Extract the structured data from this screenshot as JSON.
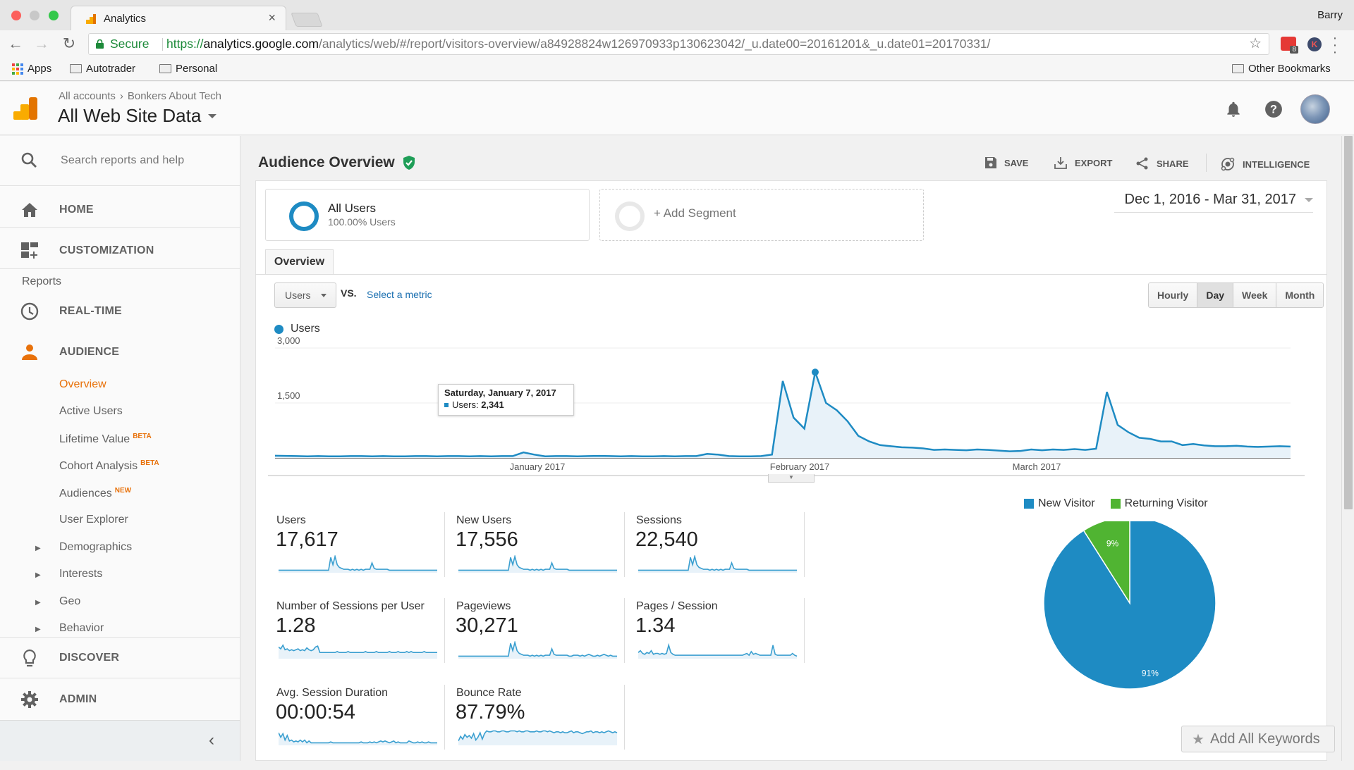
{
  "browser": {
    "tab_title": "Analytics",
    "profile_name": "Barry",
    "secure_label": "Secure",
    "url_scheme": "https://",
    "url_host": "analytics.google.com",
    "url_path": "/analytics/web/#/report/visitors-overview/a84928824w126970933p130623042/_u.date00=20161201&_u.date01=20170331/",
    "extension_badge": "8",
    "extension2_letter": "K",
    "bookmarks": [
      "Apps",
      "Autotrader",
      "Personal"
    ],
    "other_bookmarks": "Other Bookmarks"
  },
  "header": {
    "breadcrumb_account": "All accounts",
    "breadcrumb_property": "Bonkers About Tech",
    "view_name": "All Web Site Data"
  },
  "sidebar": {
    "search_placeholder": "Search reports and help",
    "home": "HOME",
    "customization": "CUSTOMIZATION",
    "reports_heading": "Reports",
    "realtime": "REAL-TIME",
    "audience": "AUDIENCE",
    "audience_items": [
      {
        "label": "Overview",
        "badge": ""
      },
      {
        "label": "Active Users",
        "badge": ""
      },
      {
        "label": "Lifetime Value",
        "badge": "BETA"
      },
      {
        "label": "Cohort Analysis",
        "badge": "BETA"
      },
      {
        "label": "Audiences",
        "badge": "NEW"
      },
      {
        "label": "User Explorer",
        "badge": ""
      },
      {
        "label": "Demographics",
        "badge": ""
      },
      {
        "label": "Interests",
        "badge": ""
      },
      {
        "label": "Geo",
        "badge": ""
      },
      {
        "label": "Behavior",
        "badge": ""
      }
    ],
    "discover": "DISCOVER",
    "admin": "ADMIN"
  },
  "report": {
    "title": "Audience Overview",
    "actions": {
      "save": "SAVE",
      "export": "EXPORT",
      "share": "SHARE",
      "intelligence": "INTELLIGENCE"
    },
    "segments": {
      "active_name": "All Users",
      "active_sub": "100.00% Users",
      "add_label": "+ Add Segment"
    },
    "date_range": "Dec 1, 2016 - Mar 31, 2017",
    "tab": "Overview",
    "metric_selected": "Users",
    "vs_label": "VS.",
    "select_metric": "Select a metric",
    "granularity": [
      "Hourly",
      "Day",
      "Week",
      "Month"
    ],
    "granularity_selected": "Day",
    "tooltip": {
      "date": "Saturday, January 7, 2017",
      "label": "Users:",
      "value": "2,341"
    },
    "add_keywords": "Add All Keywords",
    "kpis": [
      {
        "label": "Users",
        "value": "17,617"
      },
      {
        "label": "New Users",
        "value": "17,556"
      },
      {
        "label": "Sessions",
        "value": "22,540"
      },
      {
        "label": "Number of Sessions per User",
        "value": "1.28"
      },
      {
        "label": "Pageviews",
        "value": "30,271"
      },
      {
        "label": "Pages / Session",
        "value": "1.34"
      },
      {
        "label": "Avg. Session Duration",
        "value": "00:00:54"
      },
      {
        "label": "Bounce Rate",
        "value": "87.79%"
      }
    ]
  },
  "colors": {
    "accent": "#1e8bc3",
    "returning": "#50b432",
    "active_nav": "#e8710a",
    "verified": "#1e9e57"
  },
  "chart_data": [
    {
      "type": "area",
      "title": "",
      "legend": [
        "Users"
      ],
      "ylabel": "",
      "xlabel": "",
      "ylim": [
        0,
        3000
      ],
      "y_ticks": [
        "3,000",
        "1,500"
      ],
      "x_tick_labels": [
        "January 2017",
        "February 2017",
        "March 2017"
      ],
      "x_start": "2016-12-01",
      "x_end": "2017-03-31",
      "series": [
        {
          "name": "Users",
          "values": [
            60,
            55,
            50,
            45,
            50,
            45,
            45,
            50,
            50,
            45,
            50,
            45,
            45,
            50,
            50,
            45,
            50,
            50,
            45,
            50,
            45,
            50,
            50,
            150,
            90,
            45,
            50,
            50,
            45,
            50,
            55,
            50,
            45,
            50,
            45,
            45,
            50,
            45,
            50,
            50,
            110,
            90,
            50,
            45,
            45,
            50,
            90,
            2100,
            1100,
            800,
            2341,
            1500,
            1300,
            1000,
            600,
            450,
            350,
            320,
            290,
            280,
            260,
            220,
            230,
            220,
            210,
            230,
            220,
            200,
            180,
            190,
            230,
            210,
            230,
            220,
            240,
            220,
            250,
            1800,
            900,
            700,
            550,
            520,
            450,
            450,
            350,
            380,
            340,
            320,
            320,
            330,
            310,
            300,
            310,
            320,
            310
          ]
        }
      ],
      "annotations": [
        {
          "date": "2017-01-07",
          "value": 2341,
          "label": "Saturday, January 7, 2017"
        }
      ]
    },
    {
      "type": "pie",
      "title": "",
      "legend_position": "top",
      "categories": [
        "New Visitor",
        "Returning Visitor"
      ],
      "values": [
        91,
        9
      ],
      "labels": [
        "91%",
        "9%"
      ]
    }
  ]
}
